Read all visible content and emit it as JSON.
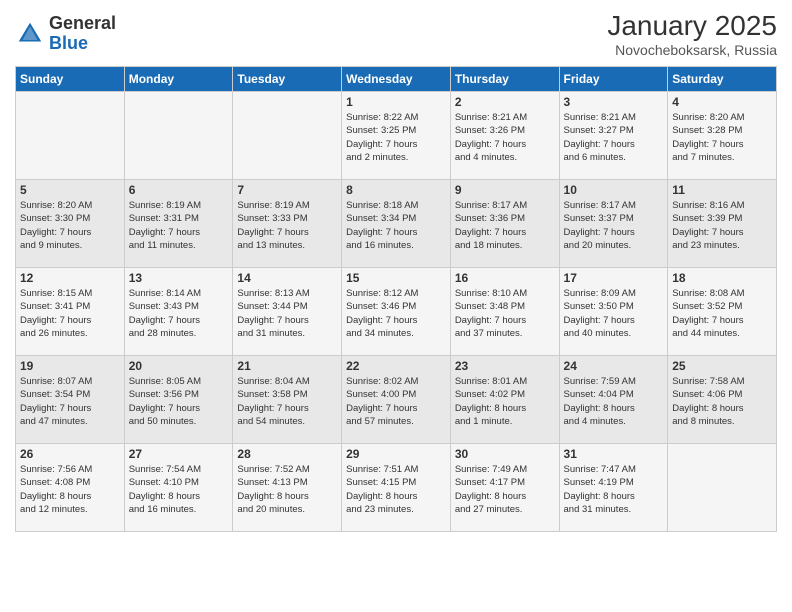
{
  "header": {
    "logo_line1": "General",
    "logo_line2": "Blue",
    "month": "January 2025",
    "location": "Novocheboksarsk, Russia"
  },
  "days_of_week": [
    "Sunday",
    "Monday",
    "Tuesday",
    "Wednesday",
    "Thursday",
    "Friday",
    "Saturday"
  ],
  "weeks": [
    [
      {
        "day": "",
        "info": ""
      },
      {
        "day": "",
        "info": ""
      },
      {
        "day": "",
        "info": ""
      },
      {
        "day": "1",
        "info": "Sunrise: 8:22 AM\nSunset: 3:25 PM\nDaylight: 7 hours\nand 2 minutes."
      },
      {
        "day": "2",
        "info": "Sunrise: 8:21 AM\nSunset: 3:26 PM\nDaylight: 7 hours\nand 4 minutes."
      },
      {
        "day": "3",
        "info": "Sunrise: 8:21 AM\nSunset: 3:27 PM\nDaylight: 7 hours\nand 6 minutes."
      },
      {
        "day": "4",
        "info": "Sunrise: 8:20 AM\nSunset: 3:28 PM\nDaylight: 7 hours\nand 7 minutes."
      }
    ],
    [
      {
        "day": "5",
        "info": "Sunrise: 8:20 AM\nSunset: 3:30 PM\nDaylight: 7 hours\nand 9 minutes."
      },
      {
        "day": "6",
        "info": "Sunrise: 8:19 AM\nSunset: 3:31 PM\nDaylight: 7 hours\nand 11 minutes."
      },
      {
        "day": "7",
        "info": "Sunrise: 8:19 AM\nSunset: 3:33 PM\nDaylight: 7 hours\nand 13 minutes."
      },
      {
        "day": "8",
        "info": "Sunrise: 8:18 AM\nSunset: 3:34 PM\nDaylight: 7 hours\nand 16 minutes."
      },
      {
        "day": "9",
        "info": "Sunrise: 8:17 AM\nSunset: 3:36 PM\nDaylight: 7 hours\nand 18 minutes."
      },
      {
        "day": "10",
        "info": "Sunrise: 8:17 AM\nSunset: 3:37 PM\nDaylight: 7 hours\nand 20 minutes."
      },
      {
        "day": "11",
        "info": "Sunrise: 8:16 AM\nSunset: 3:39 PM\nDaylight: 7 hours\nand 23 minutes."
      }
    ],
    [
      {
        "day": "12",
        "info": "Sunrise: 8:15 AM\nSunset: 3:41 PM\nDaylight: 7 hours\nand 26 minutes."
      },
      {
        "day": "13",
        "info": "Sunrise: 8:14 AM\nSunset: 3:43 PM\nDaylight: 7 hours\nand 28 minutes."
      },
      {
        "day": "14",
        "info": "Sunrise: 8:13 AM\nSunset: 3:44 PM\nDaylight: 7 hours\nand 31 minutes."
      },
      {
        "day": "15",
        "info": "Sunrise: 8:12 AM\nSunset: 3:46 PM\nDaylight: 7 hours\nand 34 minutes."
      },
      {
        "day": "16",
        "info": "Sunrise: 8:10 AM\nSunset: 3:48 PM\nDaylight: 7 hours\nand 37 minutes."
      },
      {
        "day": "17",
        "info": "Sunrise: 8:09 AM\nSunset: 3:50 PM\nDaylight: 7 hours\nand 40 minutes."
      },
      {
        "day": "18",
        "info": "Sunrise: 8:08 AM\nSunset: 3:52 PM\nDaylight: 7 hours\nand 44 minutes."
      }
    ],
    [
      {
        "day": "19",
        "info": "Sunrise: 8:07 AM\nSunset: 3:54 PM\nDaylight: 7 hours\nand 47 minutes."
      },
      {
        "day": "20",
        "info": "Sunrise: 8:05 AM\nSunset: 3:56 PM\nDaylight: 7 hours\nand 50 minutes."
      },
      {
        "day": "21",
        "info": "Sunrise: 8:04 AM\nSunset: 3:58 PM\nDaylight: 7 hours\nand 54 minutes."
      },
      {
        "day": "22",
        "info": "Sunrise: 8:02 AM\nSunset: 4:00 PM\nDaylight: 7 hours\nand 57 minutes."
      },
      {
        "day": "23",
        "info": "Sunrise: 8:01 AM\nSunset: 4:02 PM\nDaylight: 8 hours\nand 1 minute."
      },
      {
        "day": "24",
        "info": "Sunrise: 7:59 AM\nSunset: 4:04 PM\nDaylight: 8 hours\nand 4 minutes."
      },
      {
        "day": "25",
        "info": "Sunrise: 7:58 AM\nSunset: 4:06 PM\nDaylight: 8 hours\nand 8 minutes."
      }
    ],
    [
      {
        "day": "26",
        "info": "Sunrise: 7:56 AM\nSunset: 4:08 PM\nDaylight: 8 hours\nand 12 minutes."
      },
      {
        "day": "27",
        "info": "Sunrise: 7:54 AM\nSunset: 4:10 PM\nDaylight: 8 hours\nand 16 minutes."
      },
      {
        "day": "28",
        "info": "Sunrise: 7:52 AM\nSunset: 4:13 PM\nDaylight: 8 hours\nand 20 minutes."
      },
      {
        "day": "29",
        "info": "Sunrise: 7:51 AM\nSunset: 4:15 PM\nDaylight: 8 hours\nand 23 minutes."
      },
      {
        "day": "30",
        "info": "Sunrise: 7:49 AM\nSunset: 4:17 PM\nDaylight: 8 hours\nand 27 minutes."
      },
      {
        "day": "31",
        "info": "Sunrise: 7:47 AM\nSunset: 4:19 PM\nDaylight: 8 hours\nand 31 minutes."
      },
      {
        "day": "",
        "info": ""
      }
    ]
  ]
}
